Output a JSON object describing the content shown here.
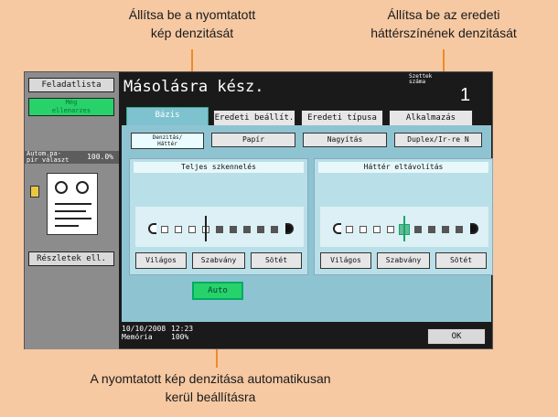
{
  "callouts": {
    "top_left_line1": "Állítsa be a nyomtatott",
    "top_left_line2": "kép denzitását",
    "top_right_line1": "Állítsa be az eredeti",
    "top_right_line2": "háttérszínének denzitását",
    "bottom_line1": "A nyomtatott kép denzitása automatikusan",
    "bottom_line2": "kerül beállításra"
  },
  "sidebar": {
    "feladatlista": "Feladatlista",
    "meg_line1": "Még",
    "meg_line2": "ellenarzes",
    "zoom_label_line1": "Autom.pa-",
    "zoom_label_line2": "pír választ",
    "zoom_value": "100.0%",
    "reszletek": "Részletek ell."
  },
  "header": {
    "title": "Másolásra kész.",
    "szettek_line1": "Szettek",
    "szettek_line2": "száma",
    "count": "1"
  },
  "tabs": {
    "bazis": "Bázis",
    "eredeti_beallit": "Eredeti beállít.",
    "eredeti_tipusa": "Eredeti típusa",
    "alkalmazas": "Alkalmazás"
  },
  "subtabs": {
    "denzitas_line1": "Denzitás/",
    "denzitas_line2": "Háttér",
    "papir": "Papír",
    "nagyitas": "Nagyítás",
    "duplex": "Duplex/Ir-re N"
  },
  "panels": {
    "left": {
      "heading": "Teljes szkennelés",
      "selected_level": 4,
      "levels": 9,
      "buttons": [
        "Világos",
        "Szabvány",
        "Sötét"
      ]
    },
    "right": {
      "heading": "Háttér eltávolítás",
      "selected_level": 5,
      "levels": 9,
      "buttons": [
        "Világos",
        "Szabvány",
        "Sötét"
      ]
    }
  },
  "auto_label": "Auto",
  "footer": {
    "date": "10/10/2008",
    "time": "12:23",
    "memoria_label": "Memória",
    "memoria_value": "100%"
  },
  "ok_label": "OK",
  "colors": {
    "background": "#f6c9a3",
    "accent_green": "#28d26a",
    "leader_orange": "#f08a24",
    "panel_blue": "#8ec4d2"
  }
}
